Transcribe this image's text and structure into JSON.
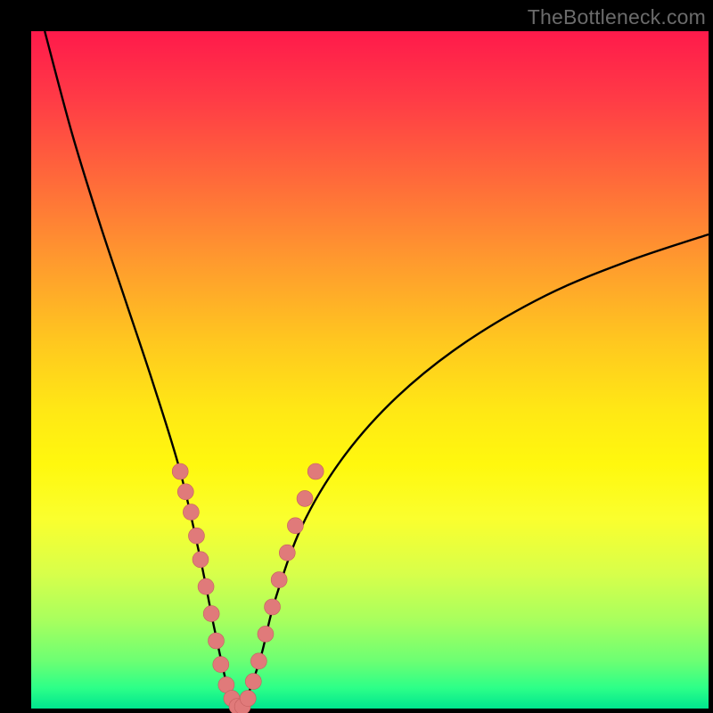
{
  "watermark": "TheBottleneck.com",
  "colors": {
    "curve_stroke": "#000000",
    "marker_fill": "#e07a7a",
    "marker_stroke": "#c55f5f",
    "background_black": "#000000"
  },
  "chart_data": {
    "type": "line",
    "title": "",
    "xlabel": "",
    "ylabel": "",
    "xlim": [
      0,
      100
    ],
    "ylim": [
      0,
      100
    ],
    "series": [
      {
        "name": "bottleneck-curve",
        "comment": "V-shaped curve; y≈100 at x≈2, drops to y≈0 near x≈30, rises to y≈70 at x≈100",
        "x": [
          2,
          6,
          10,
          14,
          18,
          22,
          25,
          27,
          29,
          30,
          31,
          32,
          34,
          36,
          40,
          46,
          54,
          64,
          76,
          88,
          100
        ],
        "y": [
          100,
          85,
          72,
          60,
          48,
          35,
          22,
          12,
          3,
          0,
          0,
          2,
          8,
          16,
          27,
          37,
          46,
          54,
          61,
          66,
          70
        ]
      }
    ],
    "markers": {
      "comment": "pink bead markers clustered along both walls of the V and along its floor; approximate positions in 0–100 axis space",
      "points": [
        {
          "x": 22.0,
          "y": 35.0
        },
        {
          "x": 22.8,
          "y": 32.0
        },
        {
          "x": 23.6,
          "y": 29.0
        },
        {
          "x": 24.4,
          "y": 25.5
        },
        {
          "x": 25.0,
          "y": 22.0
        },
        {
          "x": 25.8,
          "y": 18.0
        },
        {
          "x": 26.6,
          "y": 14.0
        },
        {
          "x": 27.3,
          "y": 10.0
        },
        {
          "x": 28.0,
          "y": 6.5
        },
        {
          "x": 28.8,
          "y": 3.5
        },
        {
          "x": 29.6,
          "y": 1.5
        },
        {
          "x": 30.4,
          "y": 0.3
        },
        {
          "x": 31.2,
          "y": 0.3
        },
        {
          "x": 32.0,
          "y": 1.5
        },
        {
          "x": 32.8,
          "y": 4.0
        },
        {
          "x": 33.6,
          "y": 7.0
        },
        {
          "x": 34.6,
          "y": 11.0
        },
        {
          "x": 35.6,
          "y": 15.0
        },
        {
          "x": 36.6,
          "y": 19.0
        },
        {
          "x": 37.8,
          "y": 23.0
        },
        {
          "x": 39.0,
          "y": 27.0
        },
        {
          "x": 40.4,
          "y": 31.0
        },
        {
          "x": 42.0,
          "y": 35.0
        }
      ]
    }
  }
}
